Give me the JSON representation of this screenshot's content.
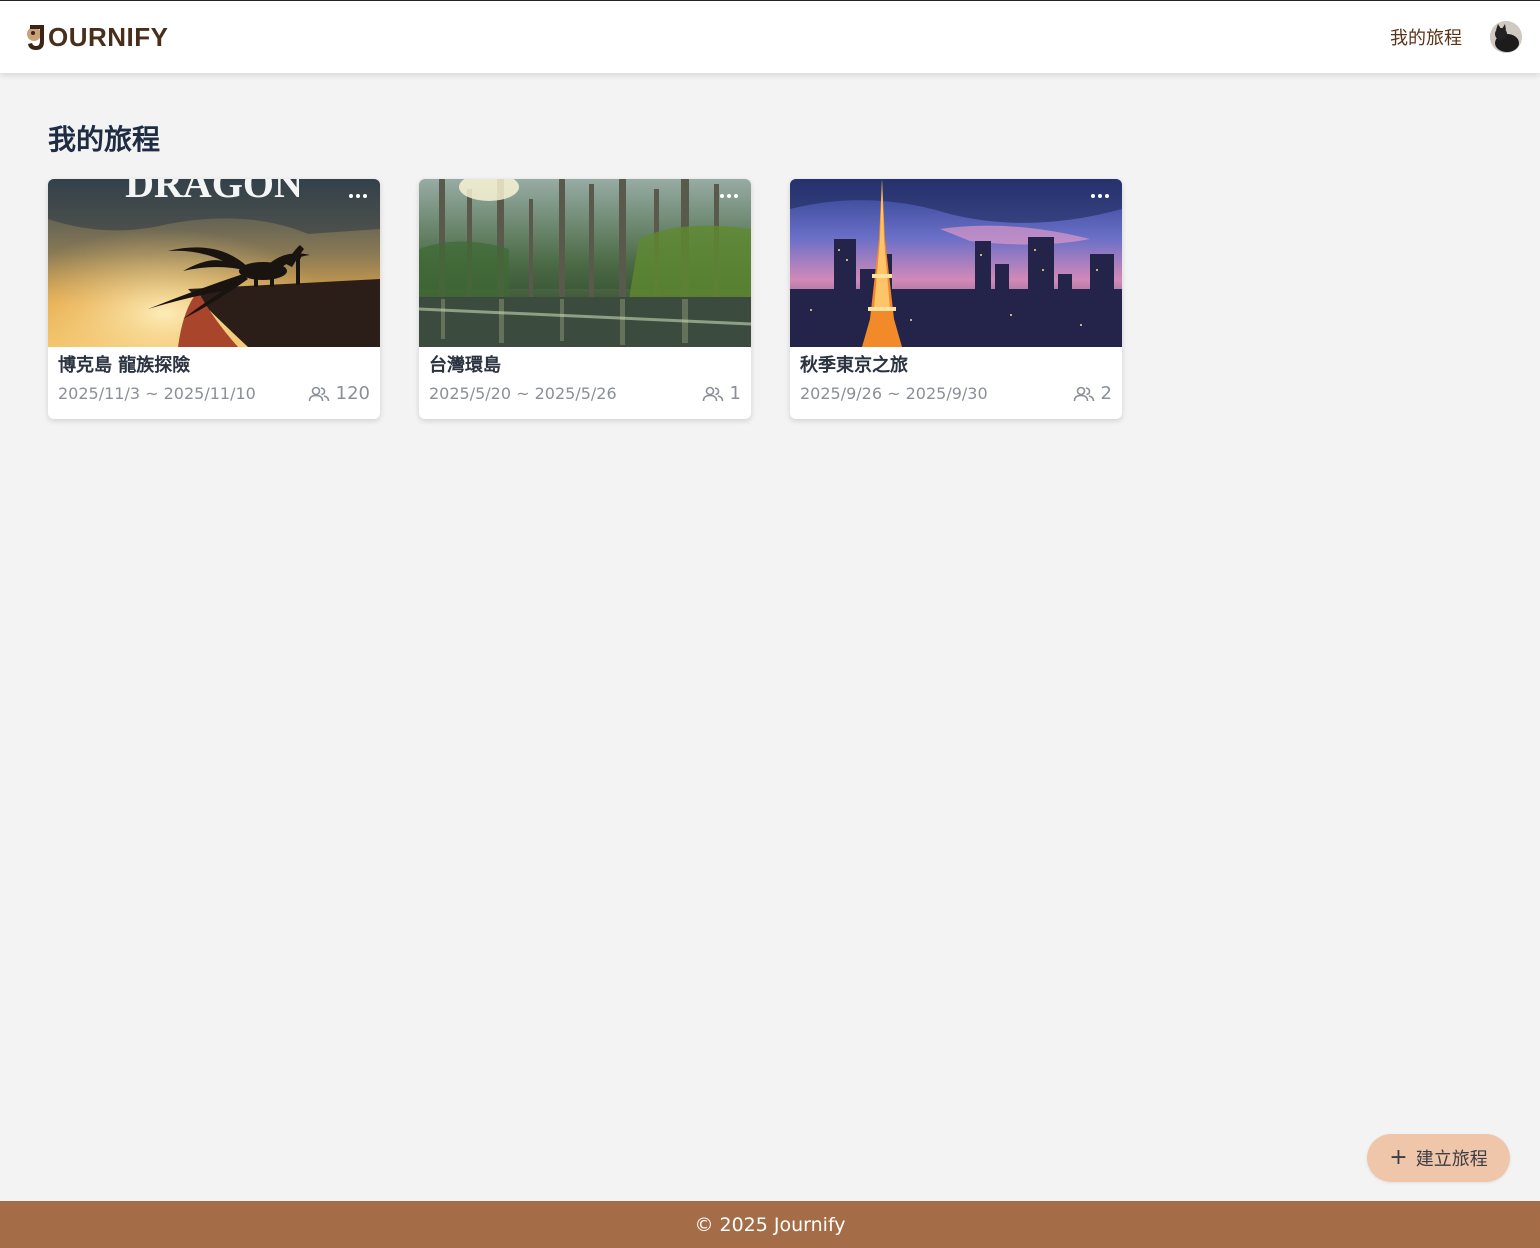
{
  "header": {
    "logo_text": "OURNIFY",
    "nav_link": "我的旅程"
  },
  "main": {
    "title": "我的旅程",
    "trips": [
      {
        "title": "博克島 龍族探險",
        "dates": "2025/11/3 ~ 2025/11/10",
        "members": "120",
        "image_text": "DRAGON"
      },
      {
        "title": "台灣環島",
        "dates": "2025/5/20 ~ 2025/5/26",
        "members": "1"
      },
      {
        "title": "秋季東京之旅",
        "dates": "2025/9/26 ~ 2025/9/30",
        "members": "2"
      }
    ]
  },
  "fab": {
    "label": "建立旅程"
  },
  "footer": {
    "copyright": "© 2025 Journify"
  },
  "colors": {
    "header_bg": "#ffffff",
    "page_bg": "#f3f3f3",
    "footer_bg": "#a46d48",
    "fab_bg": "#efc6a9",
    "brand_text": "#4a2e1c"
  }
}
